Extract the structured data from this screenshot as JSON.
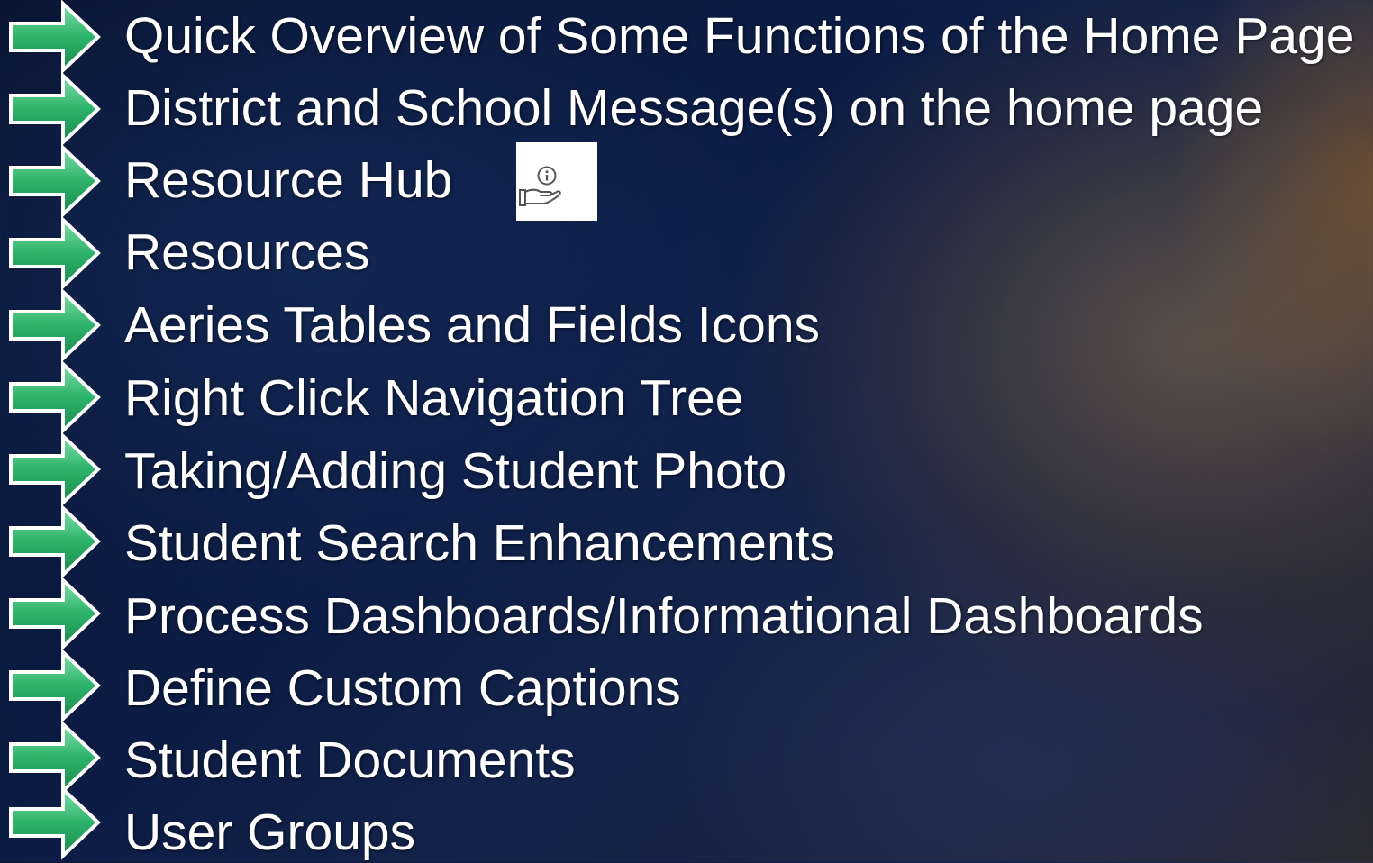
{
  "items": [
    {
      "label": "Quick Overview of Some Functions of the Home Page"
    },
    {
      "label": "District and School Message(s) on the home page"
    },
    {
      "label": "Resource Hub",
      "icon": "resource-hub-icon"
    },
    {
      "label": "Resources"
    },
    {
      "label": "Aeries Tables and Fields Icons"
    },
    {
      "label": "Right Click Navigation Tree"
    },
    {
      "label": "Taking/Adding Student Photo"
    },
    {
      "label": "Student Search Enhancements"
    },
    {
      "label": "Process Dashboards/Informational Dashboards"
    },
    {
      "label": "Define Custom Captions"
    },
    {
      "label": "Student Documents"
    },
    {
      "label": "User Groups"
    }
  ],
  "colors": {
    "arrow_fill": "#2db36b",
    "arrow_light": "#7fe0a8",
    "arrow_outline": "#ffffff",
    "text": "#ffffff"
  },
  "icons": {
    "bullet": "green-arrow-icon",
    "resource_hub": "hand-info-icon"
  }
}
